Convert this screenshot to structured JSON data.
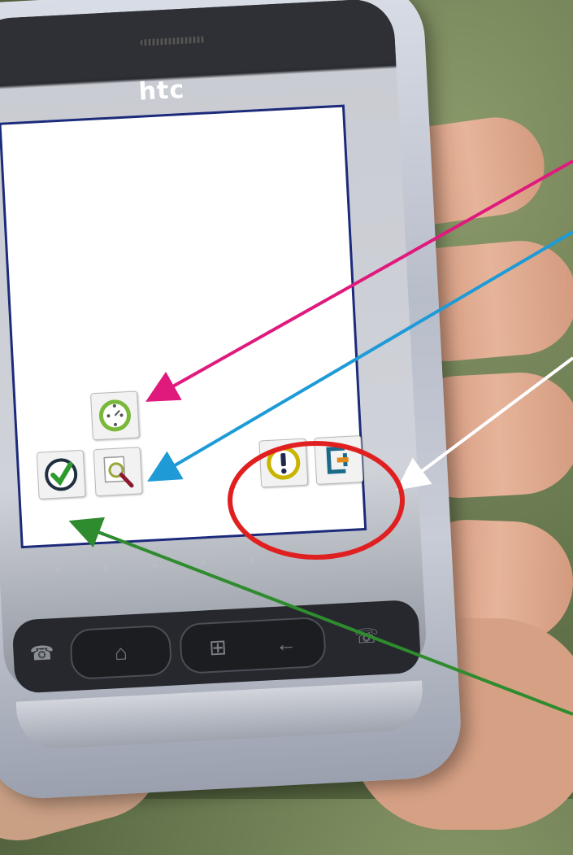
{
  "device": {
    "brand": "htc"
  },
  "screen": {
    "icons": [
      {
        "name": "clock-history-icon",
        "color": "#7ab83a"
      },
      {
        "name": "check-mark-icon",
        "color": "#2e8b2e"
      },
      {
        "name": "search-document-icon",
        "color": "#8b1a2e"
      },
      {
        "name": "alert-icon",
        "color": "#c4b200"
      },
      {
        "name": "exit-icon",
        "color": "#1a6b8a"
      }
    ]
  },
  "hardware_buttons": [
    {
      "name": "call-icon"
    },
    {
      "name": "home-icon"
    },
    {
      "name": "windows-icon"
    },
    {
      "name": "back-icon"
    },
    {
      "name": "end-call-icon"
    }
  ],
  "annotations": {
    "arrow_colors": [
      "#e0197d",
      "#1e9bd7",
      "#ffffff",
      "#2e8b2e"
    ],
    "highlight_color": "#e02020"
  }
}
